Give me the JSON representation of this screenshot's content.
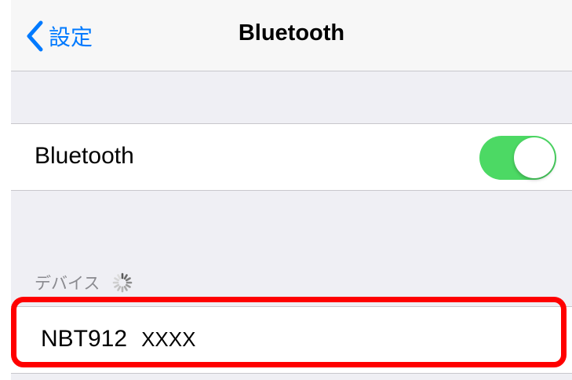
{
  "navbar": {
    "back_label": "設定",
    "title": "Bluetooth"
  },
  "bluetooth_setting": {
    "label": "Bluetooth",
    "toggle_on": true
  },
  "devices_section": {
    "header": "デバイス"
  },
  "devices": [
    {
      "name": "NBT912",
      "suffix": "XXXX"
    }
  ],
  "colors": {
    "accent": "#007aff",
    "toggle_on": "#4cd964",
    "highlight": "#ff0000",
    "background": "#efeff4"
  },
  "icons": {
    "back": "chevron-left-icon",
    "loading": "spinner-icon"
  }
}
